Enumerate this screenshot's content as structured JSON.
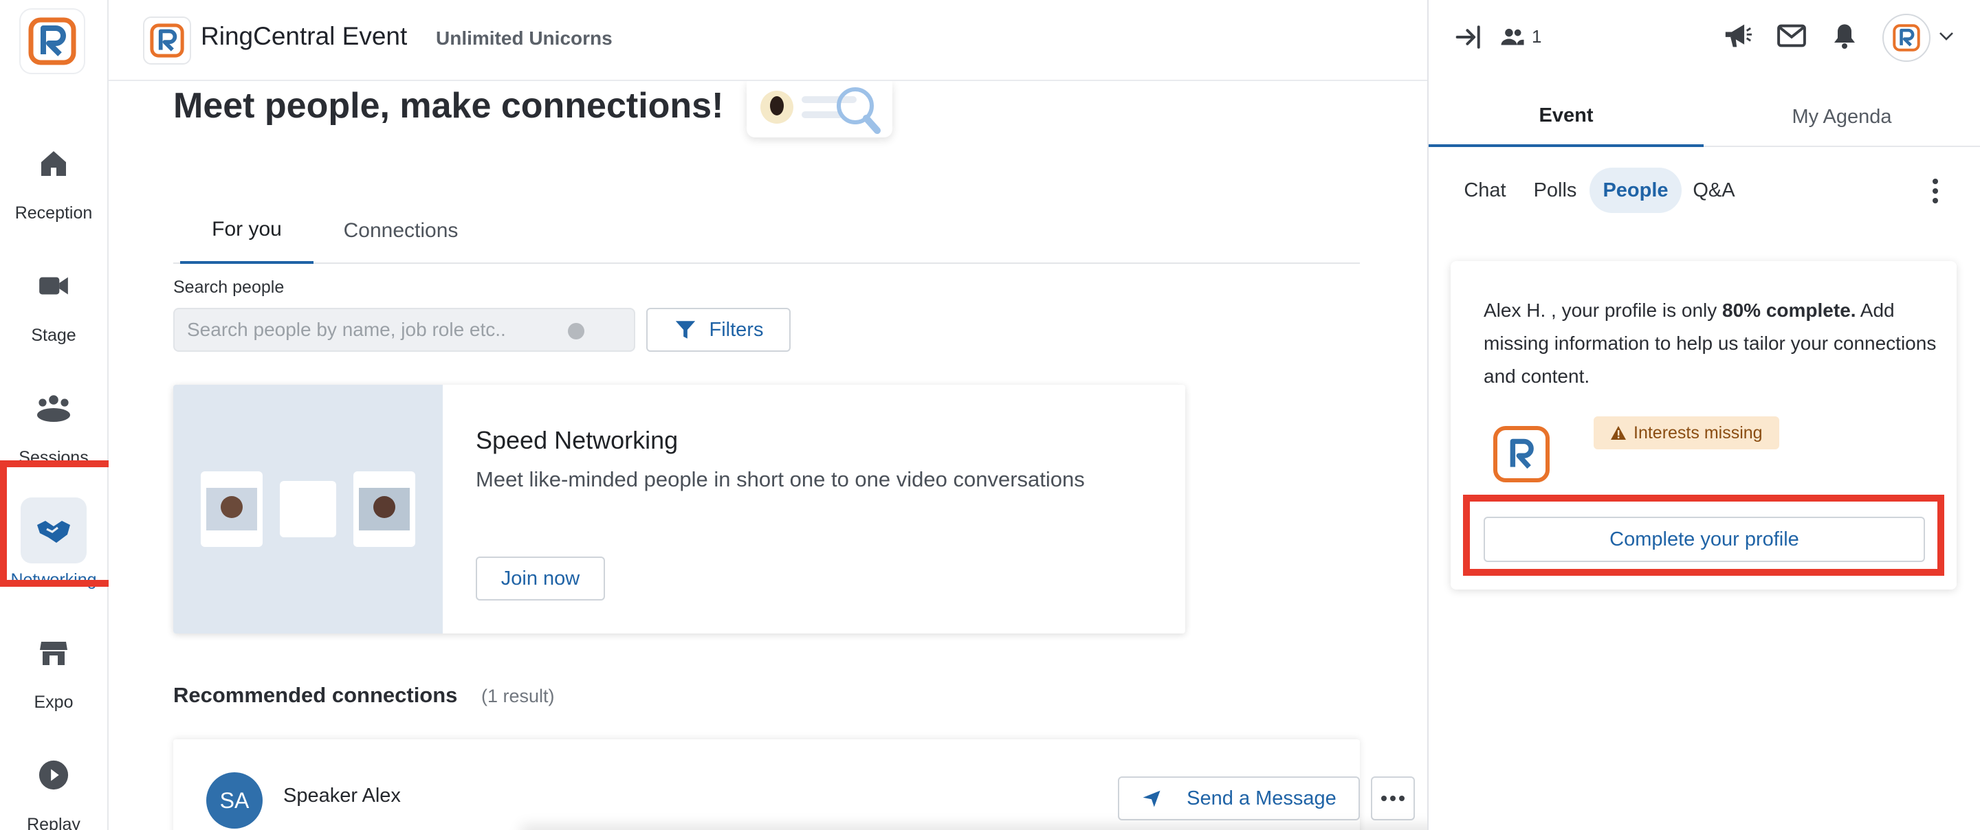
{
  "app": {
    "title": "RingCentral Event",
    "event_name": "Unlimited Unicorns",
    "brand_color": "#1f63a6",
    "logo_orange": "#e8722a",
    "logo_blue": "#2f6fab",
    "highlight_color": "#e8392b"
  },
  "nav": {
    "items": [
      {
        "label": "Reception",
        "icon": "home-icon"
      },
      {
        "label": "Stage",
        "icon": "video-camera-icon"
      },
      {
        "label": "Sessions",
        "icon": "group-icon"
      },
      {
        "label": "Networking",
        "icon": "handshake-icon",
        "active": true
      },
      {
        "label": "Expo",
        "icon": "storefront-icon"
      },
      {
        "label": "Replay",
        "icon": "play-circle-icon"
      }
    ]
  },
  "main": {
    "heading": "Meet people, make connections!",
    "tabs": [
      {
        "label": "For you",
        "active": true
      },
      {
        "label": "Connections"
      }
    ],
    "search": {
      "label": "Search people",
      "placeholder": "Search people by name, job role etc..",
      "value": ""
    },
    "filters_label": "Filters",
    "speed_networking": {
      "title": "Speed Networking",
      "description": "Meet like-minded people in short one to one video conversations",
      "button": "Join now"
    },
    "recommended": {
      "title": "Recommended connections",
      "count": "(1 result)",
      "people": [
        {
          "initials": "SA",
          "name": "Speaker Alex",
          "message_button": "Send a Message"
        }
      ]
    }
  },
  "right_panel": {
    "attendee_count": "1",
    "tabs": [
      {
        "label": "Event",
        "active": true
      },
      {
        "label": "My Agenda"
      }
    ],
    "subtabs": [
      {
        "label": "Chat"
      },
      {
        "label": "Polls"
      },
      {
        "label": "People",
        "active": true
      },
      {
        "label": "Q&A"
      }
    ],
    "profile_card": {
      "text_before": "Alex H. , your profile is only ",
      "text_bold": "80% complete.",
      "text_after": " Add missing information to help us tailor your connections and content.",
      "badge": "Interests missing",
      "button": "Complete your profile"
    }
  }
}
